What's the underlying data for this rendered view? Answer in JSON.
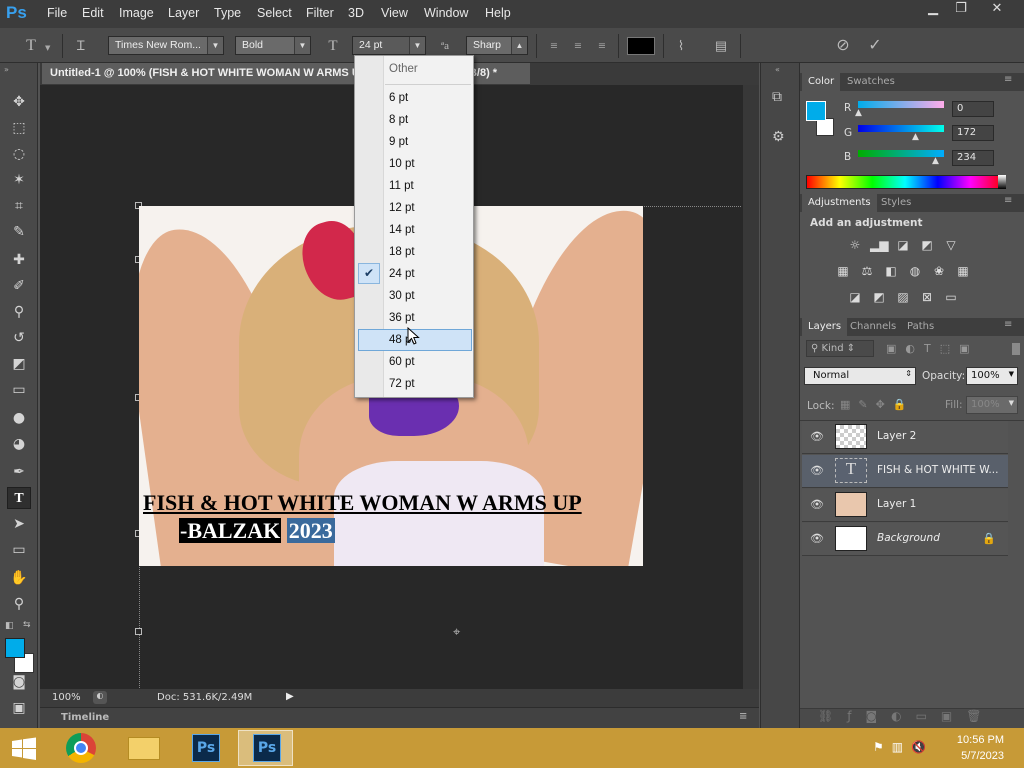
{
  "app": {
    "logo": "Ps"
  },
  "menu": {
    "items": [
      "File",
      "Edit",
      "Image",
      "Layer",
      "Type",
      "Select",
      "Filter",
      "3D",
      "View",
      "Window",
      "Help"
    ]
  },
  "window_controls": {
    "minimize": "▁",
    "restore": "❐",
    "close": "✕"
  },
  "options": {
    "font_family": "Times New Rom...",
    "font_style": "Bold",
    "font_size": "24 pt",
    "antialias": "Sharp",
    "cancel_icon": "⊘",
    "commit_icon": "✓"
  },
  "document": {
    "tab_title": "Untitled-1 @ 100% (FISH & HOT WHITE WOMAN W ARMS UP -BALZAK 2023, RGB/8) *",
    "headline": "FISH & HOT WHITE WOMAN W ARMS UP",
    "subline_a": "-BALZAK",
    "subline_b": "2023"
  },
  "status": {
    "zoom": "100%",
    "doc_size": "Doc: 531.6K/2.49M"
  },
  "timeline": {
    "label": "Timeline"
  },
  "font_size_dropdown": {
    "header": "Other",
    "items": [
      "6 pt",
      "8 pt",
      "9 pt",
      "10 pt",
      "11 pt",
      "12 pt",
      "14 pt",
      "18 pt",
      "24 pt",
      "30 pt",
      "36 pt",
      "48 pt",
      "60 pt",
      "72 pt"
    ],
    "checked": "24 pt",
    "hovered": "48 pt"
  },
  "color_panel": {
    "tabs": [
      "Color",
      "Swatches"
    ],
    "r_label": "R",
    "g_label": "G",
    "b_label": "B",
    "r_value": "0",
    "g_value": "172",
    "b_value": "234",
    "fg_color": "#00acea"
  },
  "adjustments_panel": {
    "tabs": [
      "Adjustments",
      "Styles"
    ],
    "title": "Add an adjustment"
  },
  "layers_panel": {
    "tabs": [
      "Layers",
      "Channels",
      "Paths"
    ],
    "kind_label": "Kind",
    "blend_mode": "Normal",
    "opacity_label": "Opacity:",
    "opacity_value": "100%",
    "lock_label": "Lock:",
    "fill_label": "Fill:",
    "fill_value": "100%",
    "layers": [
      {
        "name": "Layer 2"
      },
      {
        "name": "FISH & HOT WHITE W..."
      },
      {
        "name": "Layer 1"
      },
      {
        "name": "Background"
      }
    ]
  },
  "taskbar": {
    "time": "10:56 PM",
    "date": "5/7/2023"
  }
}
